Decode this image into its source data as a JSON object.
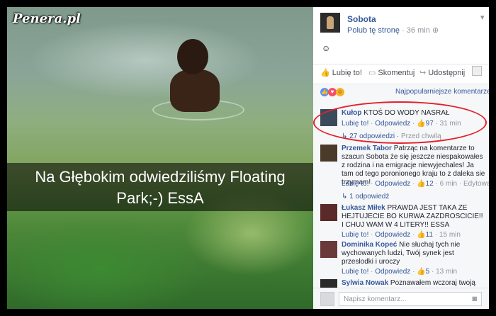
{
  "watermark": "Penera.pl",
  "caption": {
    "line1": "Na Głębokim odwiedziliśmy Floating",
    "line2": "Park;-) EssA"
  },
  "post": {
    "page_name": "Sobota",
    "like_page": "Polub tę stronę",
    "time": "36 min",
    "globe": "·",
    "emoji": "☺"
  },
  "actions": {
    "like": "Lubię to!",
    "comment": "Skomentuj",
    "share": "Udostępnij"
  },
  "reactions": {
    "sort_label": "Najpopularniejsze komentarze ▾"
  },
  "comments": [
    {
      "name": "Kułop",
      "text": "KTOŚ DO WODY NASRAŁ",
      "like": "Lubię to!",
      "reply": "Odpowiedz",
      "likes": "97",
      "time": "31 min",
      "replies": "27 odpowiedzi",
      "replies_time": "Przed chwilą"
    },
    {
      "name": "Przemek Tabor",
      "text": "Patrząc na komentarze to szacun Sobota że się jeszcze niespakowałes z rodzina i na emigracje niewyjechales! Ja tam od tego poronionego kraju to z daleka sie trzymam!",
      "like": "Lubię to!",
      "reply": "Odpowiedz",
      "likes": "12",
      "time": "6 min",
      "edited": "Edytowany",
      "replies": "1 odpowiedź"
    },
    {
      "name": "Łukasz Miłek",
      "text": "PRAWDA JEST TAKA ZE HEJTUJECIE BO KURWA ZAZDROSCICIE!! I CHUJ WAM W 4 LITERY!! ESSA",
      "like": "Lubię to!",
      "reply": "Odpowiedz",
      "likes": "11",
      "time": "15 min"
    },
    {
      "name": "Dominika Kopeć",
      "text": "Nie słuchaj tych nie wychowanych ludzi, Twój synek jest przeslodki i uroczy",
      "like": "Lubię to!",
      "reply": "Odpowiedz",
      "likes": "5",
      "time": "13 min"
    },
    {
      "name": "Sylwia Nowak",
      "text": "Poznawałem wczoraj twoją mamusię od tyłu dogłębnie . Zapewne ona tak"
    }
  ],
  "write": {
    "placeholder": "Napisz komentarz..."
  }
}
